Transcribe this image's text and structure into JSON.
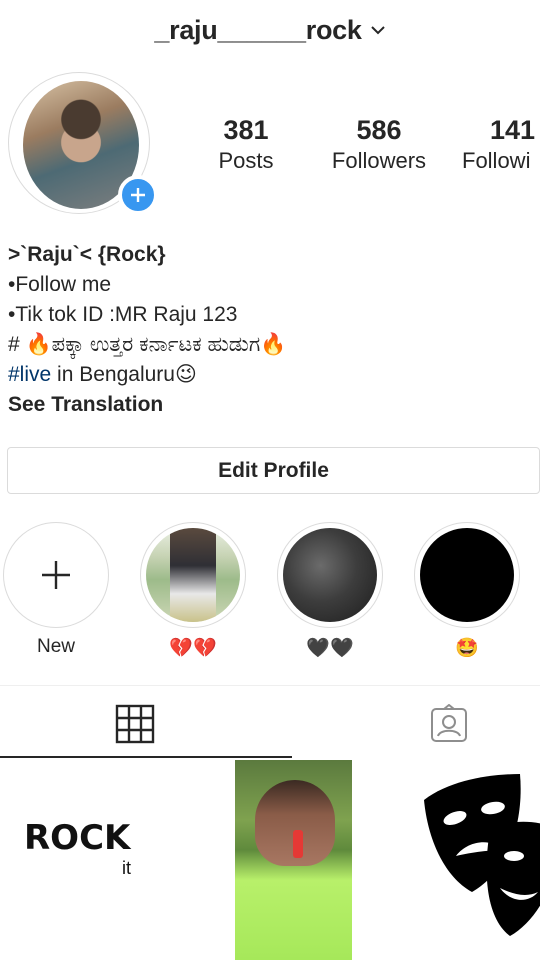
{
  "header": {
    "username": "_raju______rock",
    "chevron_icon": "chevron-down-icon"
  },
  "profile": {
    "avatar_icon": "profile-avatar",
    "add_story_icon": "plus-icon",
    "badge_color": "#3897f0",
    "stats": [
      {
        "value": "381",
        "label": "Posts"
      },
      {
        "value": "586",
        "label": "Followers"
      },
      {
        "value": "141",
        "label": "Followi"
      }
    ]
  },
  "bio": {
    "name": ">`Raju`< {Rock}",
    "line1": "•Follow me",
    "line2": "•Tik tok ID :MR Raju 123",
    "line3": "# 🔥ಪಕ್ಕಾ ಉತ್ತರ ಕರ್ನಾಟಕ ಹುಡುಗ🔥",
    "line4_hashtag": "#live",
    "line4_rest": " in Bengaluru😉",
    "see_translation": "See Translation",
    "hashtag_color": "#003569"
  },
  "edit_profile": {
    "label": "Edit Profile"
  },
  "highlights": [
    {
      "label": "New",
      "icon": "plus-icon"
    },
    {
      "label": "💔💔"
    },
    {
      "label": "🖤🖤"
    },
    {
      "label": "🤩"
    }
  ],
  "tabs": {
    "grid_icon": "grid-icon",
    "tagged_icon": "tagged-person-icon"
  },
  "posts": [
    {
      "caption": "ROCK",
      "sub": "it"
    },
    {
      "caption": ""
    },
    {
      "icon": "theater-masks-icon"
    }
  ]
}
